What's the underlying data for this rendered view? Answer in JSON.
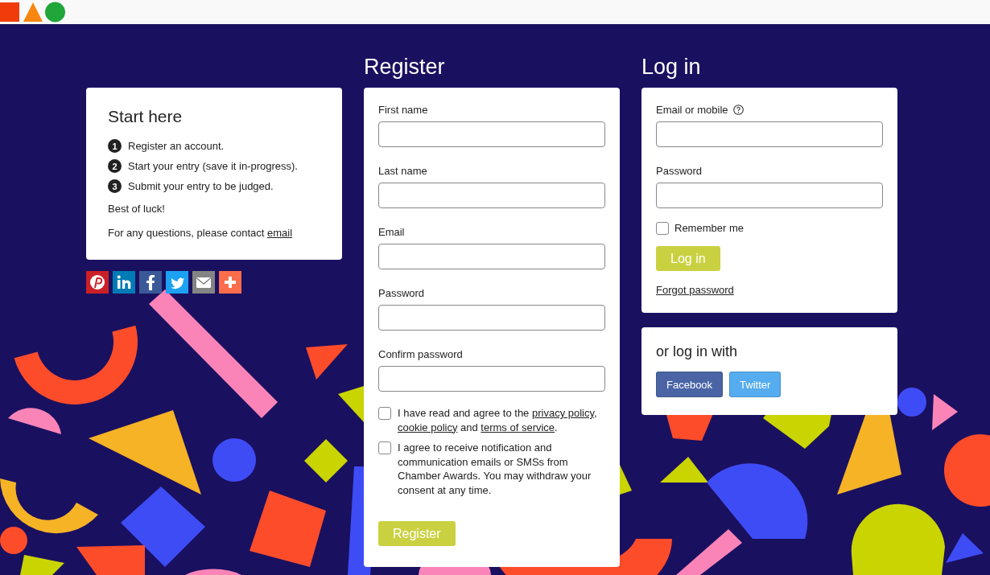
{
  "start": {
    "title": "Start here",
    "steps": [
      {
        "number": "1",
        "text": "Register an account."
      },
      {
        "number": "2",
        "text": "Start your entry (save it in-progress)."
      },
      {
        "number": "3",
        "text": "Submit your entry to be judged."
      }
    ],
    "note": "Best of luck!",
    "contact": [
      {
        "kind": "text",
        "text": "For any questions, please contact "
      },
      {
        "kind": "link",
        "text": "email"
      }
    ]
  },
  "share": [
    {
      "kind": "pinterest",
      "color": "#cb2027"
    },
    {
      "kind": "linkedin",
      "color": "#007bb5"
    },
    {
      "kind": "facebook",
      "color": "#3b5998"
    },
    {
      "kind": "twitter",
      "color": "#1da1f2"
    },
    {
      "kind": "mail",
      "color": "#848484"
    },
    {
      "kind": "more",
      "color": "#fc6d4c"
    }
  ],
  "register": {
    "heading": "Register",
    "fields": [
      {
        "label": "First name"
      },
      {
        "label": "Last name"
      },
      {
        "label": "Email"
      },
      {
        "label": "Password"
      },
      {
        "label": "Confirm password"
      }
    ],
    "consents": [
      {
        "checked": false,
        "parts": [
          {
            "kind": "text",
            "text": "I have read and agree to the "
          },
          {
            "kind": "link",
            "text": "privacy policy"
          },
          {
            "kind": "text",
            "text": ", "
          },
          {
            "kind": "link",
            "text": "cookie policy"
          },
          {
            "kind": "text",
            "text": " and "
          },
          {
            "kind": "link",
            "text": "terms of service"
          },
          {
            "kind": "text",
            "text": "."
          }
        ]
      },
      {
        "checked": false,
        "parts": [
          {
            "kind": "text",
            "text": "I agree to receive notification and communication emails or SMSs from Chamber Awards. You may withdraw your consent at any time."
          }
        ]
      }
    ],
    "button": "Register"
  },
  "login": {
    "heading": "Log in",
    "fields": [
      {
        "label": "Email or mobile",
        "help": true
      },
      {
        "label": "Password",
        "help": false
      }
    ],
    "remember": {
      "label": "Remember me",
      "checked": false
    },
    "button": "Log in",
    "forgot": "Forgot password"
  },
  "social_login": {
    "title": "or log in with",
    "buttons": [
      {
        "label": "Facebook",
        "color": "#4a64a5"
      },
      {
        "label": "Twitter",
        "color": "#55acee"
      }
    ]
  }
}
